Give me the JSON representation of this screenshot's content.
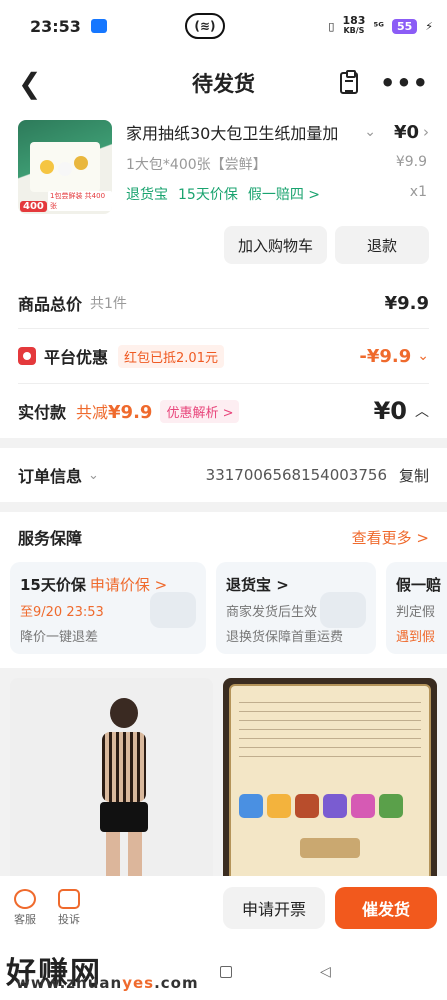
{
  "status_bar": {
    "time": "23:53",
    "center_label": "(≋)",
    "net_speed": "183",
    "net_unit": "KB/S",
    "signal": "⁵ᴳ",
    "battery": "55"
  },
  "nav": {
    "title": "待发货"
  },
  "product": {
    "name": "家用抽纸30大包卫生纸加量加",
    "price": "¥0",
    "spec": "1大包*400张【尝鲜】",
    "original_price": "¥9.9",
    "tags": [
      "退货宝",
      "15天价保",
      "假一赔四 >"
    ],
    "quantity": "x1",
    "thumb_price": "400",
    "thumb_sub": "1包尝鲜装 共400张"
  },
  "actions": {
    "add_to_cart": "加入购物车",
    "refund": "退款"
  },
  "summary": {
    "total_label": "商品总价",
    "total_count": "共1件",
    "total_value": "¥9.9",
    "promo_label": "平台优惠",
    "promo_tag": "红包已抵2.01元",
    "promo_value": "-¥9.9",
    "paid_label": "实付款",
    "saved_text": "共减",
    "saved_value": "¥9.9",
    "analysis_tag": "优惠解析 >",
    "paid_value": "¥0"
  },
  "order": {
    "label": "订单信息",
    "number": "3317006568154003756",
    "copy": "复制"
  },
  "service": {
    "title": "服务保障",
    "more": "查看更多 >",
    "cards": [
      {
        "title": "15天价保",
        "action": "申请价保 >",
        "line1": "至9/20 23:53",
        "line2": "降价一键退差"
      },
      {
        "title": "退货宝 >",
        "action": "",
        "line1": "商家发货后生效",
        "line2": "退换货保障首重运费"
      },
      {
        "title": "假一赔",
        "action": "",
        "line1": "判定假",
        "line2": "遇到假"
      }
    ]
  },
  "bottom_bar": {
    "service_label": "客服",
    "complaint_label": "投诉",
    "invoice_button": "申请开票",
    "urge_button": "催发货"
  },
  "watermark": {
    "text": "好赚网",
    "url_prefix": "www.zhuan",
    "url_accent": "yes",
    "url_suffix": ".com"
  }
}
